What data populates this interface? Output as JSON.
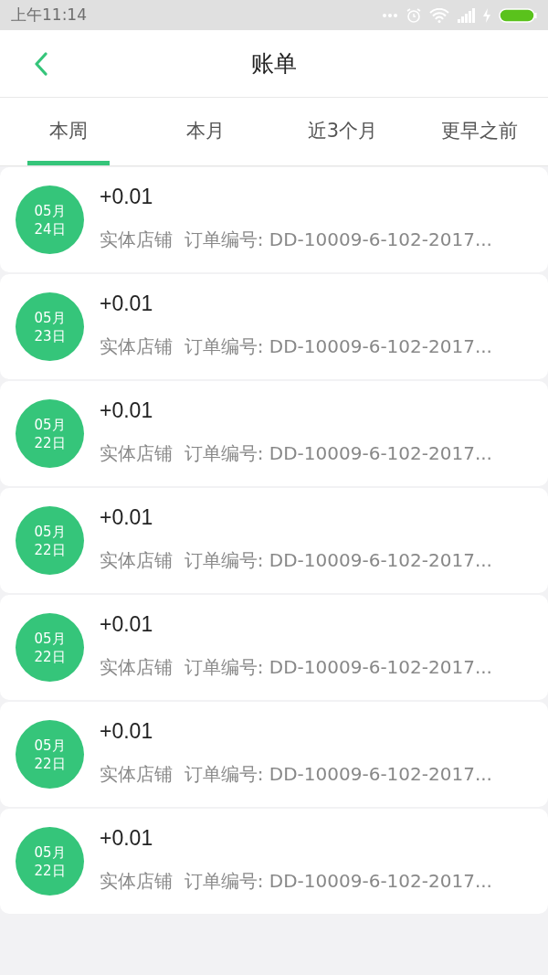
{
  "status_bar": {
    "time": "上午11:14"
  },
  "header": {
    "title": "账单"
  },
  "tabs": [
    {
      "label": "本周",
      "selected": true
    },
    {
      "label": "本月",
      "selected": false
    },
    {
      "label": "近3个月",
      "selected": false
    },
    {
      "label": "更早之前",
      "selected": false
    }
  ],
  "bills": [
    {
      "month": "05月",
      "day": "24日",
      "amount": "+0.01",
      "detail": "实体店铺  订单编号: DD-10009-6-102-2017..."
    },
    {
      "month": "05月",
      "day": "23日",
      "amount": "+0.01",
      "detail": "实体店铺  订单编号: DD-10009-6-102-2017..."
    },
    {
      "month": "05月",
      "day": "22日",
      "amount": "+0.01",
      "detail": "实体店铺  订单编号: DD-10009-6-102-2017..."
    },
    {
      "month": "05月",
      "day": "22日",
      "amount": "+0.01",
      "detail": "实体店铺  订单编号: DD-10009-6-102-2017..."
    },
    {
      "month": "05月",
      "day": "22日",
      "amount": "+0.01",
      "detail": "实体店铺  订单编号: DD-10009-6-102-2017..."
    },
    {
      "month": "05月",
      "day": "22日",
      "amount": "+0.01",
      "detail": "实体店铺  订单编号: DD-10009-6-102-2017..."
    },
    {
      "month": "05月",
      "day": "22日",
      "amount": "+0.01",
      "detail": "实体店铺  订单编号: DD-10009-6-102-2017..."
    }
  ]
}
